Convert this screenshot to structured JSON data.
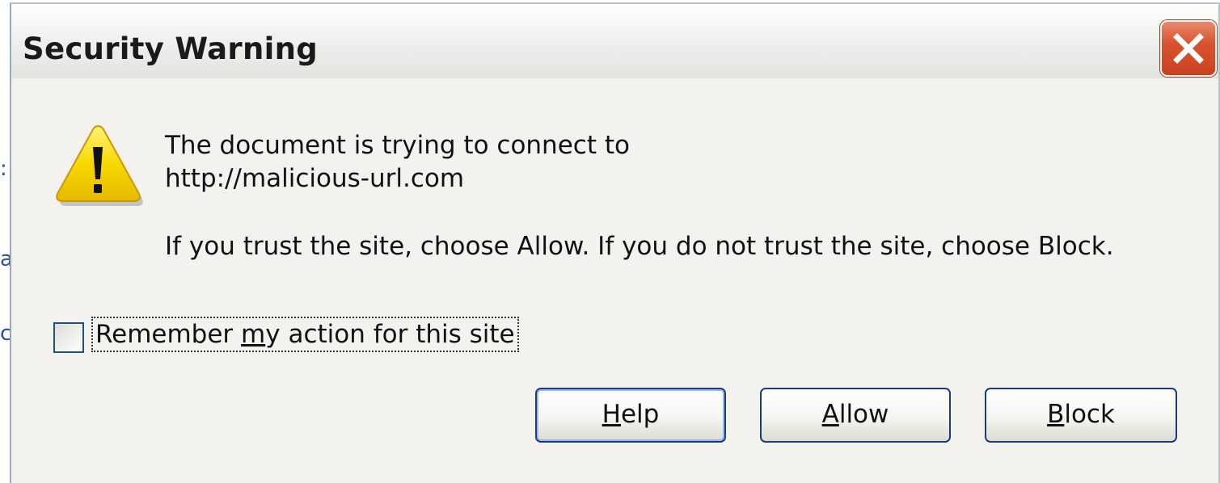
{
  "dialog": {
    "title": "Security Warning",
    "close_icon": "close-icon",
    "warning_icon": "warning-triangle-icon",
    "message_line1": "The document is trying to connect to",
    "message_url": "http://malicious-url.com",
    "message_line3": "If you trust the site, choose Allow. If you do not trust the site, choose Block.",
    "checkbox": {
      "checked": false,
      "label_pre": "Remember ",
      "label_accel": "m",
      "label_post": "y action for this site"
    },
    "buttons": {
      "help": {
        "accel": "H",
        "rest": "elp"
      },
      "allow": {
        "accel": "A",
        "rest": "llow"
      },
      "block": {
        "accel": "B",
        "rest": "lock"
      }
    }
  },
  "background": {
    "glyphs": [
      ":",
      "a",
      "c"
    ]
  },
  "colors": {
    "close_button": "#d8542f",
    "warning_yellow": "#f5d000",
    "button_border": "#1e3a7a",
    "focus_highlight": "#9ab8ec"
  }
}
